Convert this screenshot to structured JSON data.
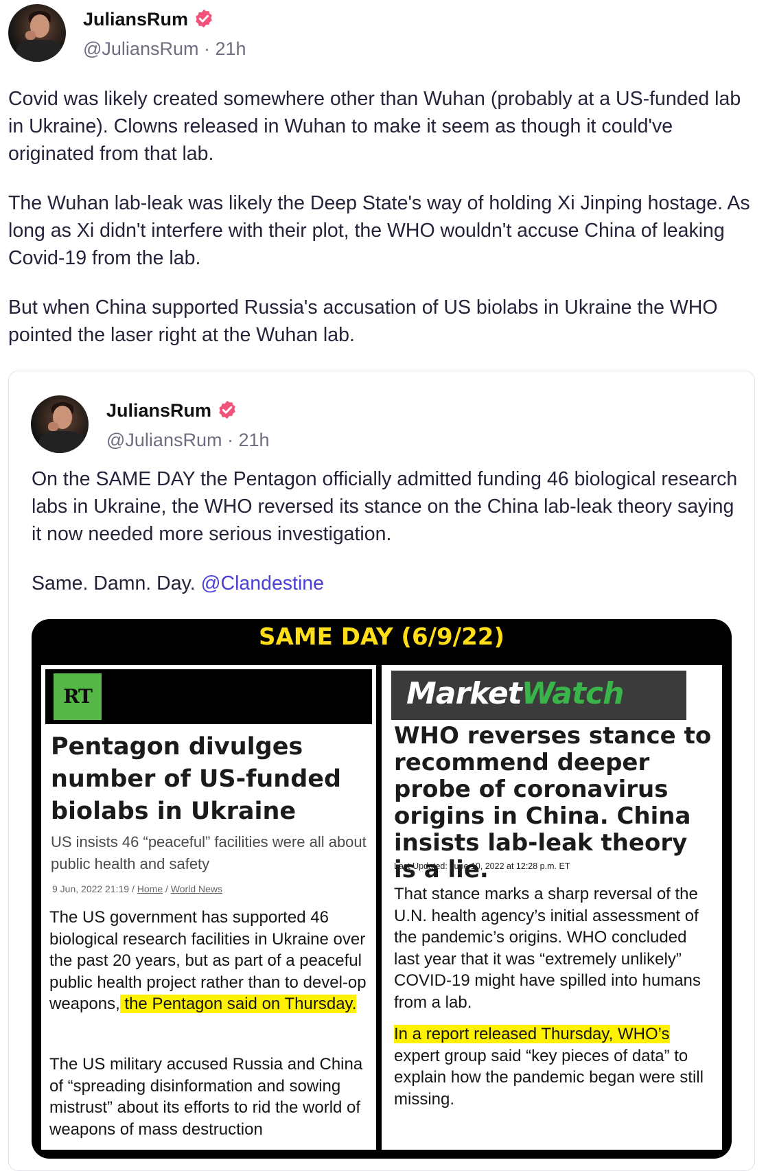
{
  "post": {
    "author": "JuliansRum",
    "handle_time": "@JuliansRum · 21h",
    "paragraphs": [
      "Covid was likely created somewhere other than Wuhan (probably at a US-funded lab in Ukraine). Clowns released in Wuhan to make it seem as though it could've originated from that lab.",
      "The Wuhan lab-leak was likely the Deep State's way of holding Xi Jinping hostage. As long as Xi didn't interfere with their plot, the WHO wouldn't accuse China of leaking Covid-19 from the lab.",
      "But when China supported Russia's accusation of US biolabs in Ukraine the WHO pointed the laser right at the Wuhan lab."
    ]
  },
  "quoted": {
    "author": "JuliansRum",
    "handle_time": "@JuliansRum · 21h",
    "paragraph1": "On the SAME DAY the Pentagon officially admitted funding 46 biological research labs in Ukraine, the WHO reversed its stance on the China lab-leak theory saying it now needed more serious investigation.",
    "paragraph2_text": "Same. Damn. Day. ",
    "paragraph2_mention": "@Clandestine"
  },
  "image": {
    "title": "SAME DAY (6/9/22)",
    "left": {
      "logo": "RT",
      "headline": "Pentagon divulges number of US-funded biolabs in Ukraine",
      "subhead": "US insists 46 “peaceful” facilities were all about public health and safety",
      "meta_date": "9 Jun, 2022 21:19",
      "meta_sep": " / ",
      "meta_link1": "Home",
      "meta_link2": "World News",
      "body1_plain": "The US government has supported 46 biological research facilities in Ukraine over the past 20 years, but as part of a peaceful public health project rather than to devel-op weapons,",
      "body1_highlight": " the Pentagon said on Thursday.",
      "body2": "The US military accused Russia and China of “spreading disinformation and sowing mistrust” about its efforts to rid the world of weapons of mass destruction"
    },
    "right": {
      "logo_part1": "Market",
      "logo_part2": "Watch",
      "headline": "WHO reverses stance to recommend deeper probe of coronavirus origins in China. China insists lab-leak theory is a lie.",
      "meta": "Last Updated: June 10, 2022 at 12:28 p.m. ET",
      "body1": "That stance marks a sharp reversal of the U.N. health agency’s initial assessment of the pandemic’s origins. WHO concluded last year that it was “extremely unlikely” COVID-19 might have spilled into humans from a lab.",
      "body2_highlight": "In a report released Thursday, WHO’s",
      "body2_plain": " expert group said “key pieces of data” to explain how the pandemic began were still missing."
    }
  },
  "colors": {
    "verified_badge": "#f0547a",
    "mention": "#4b3fd6",
    "title_yellow": "#ffde17",
    "highlight": "#fff200",
    "rt_green": "#56b947",
    "mw_green": "#3ab54a"
  }
}
